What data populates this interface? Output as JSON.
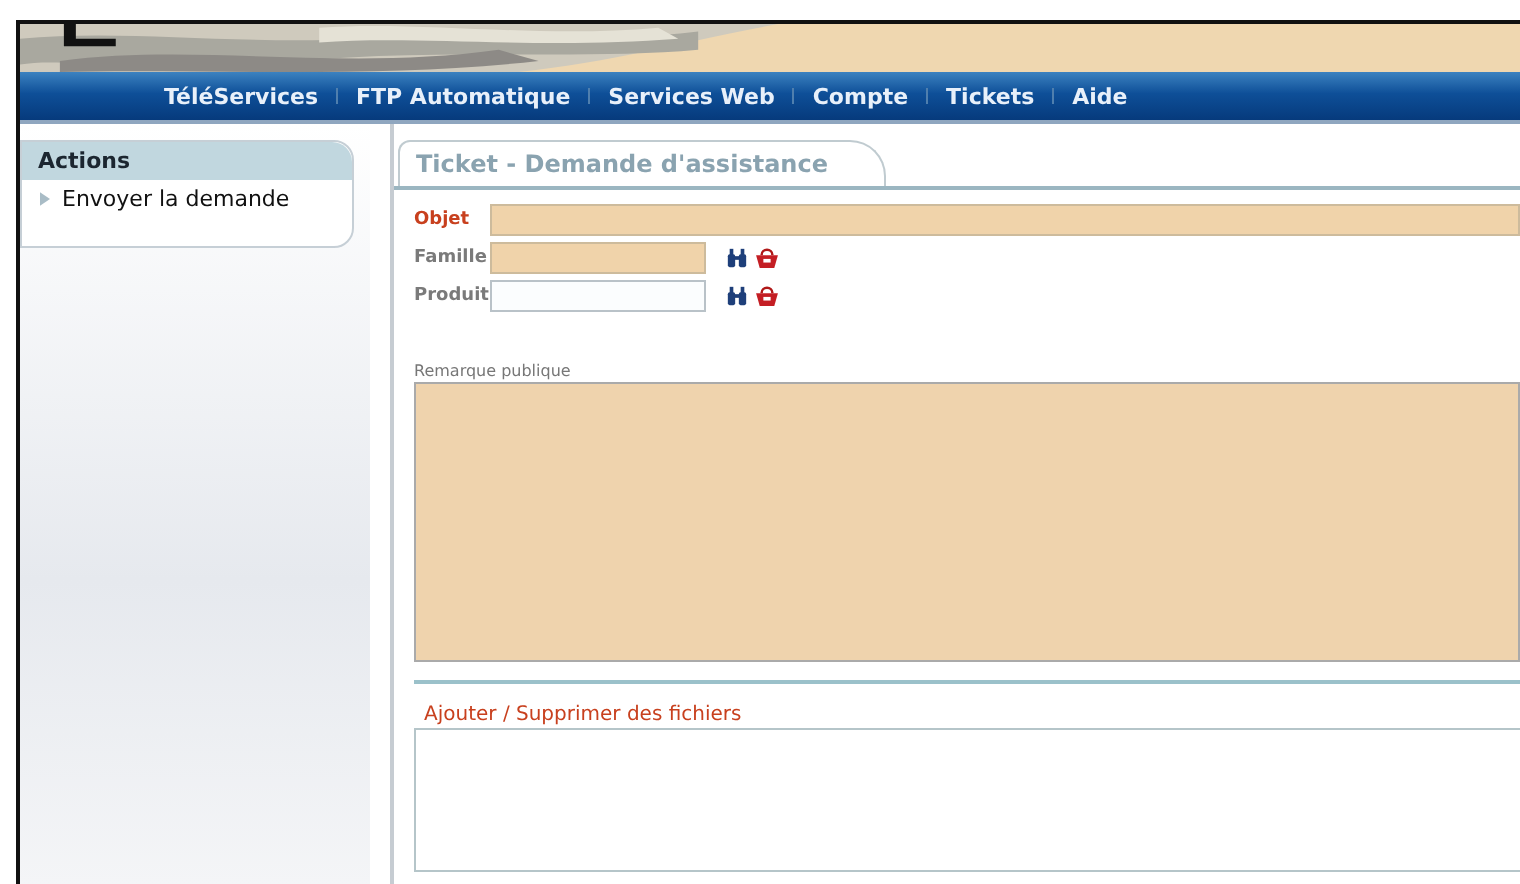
{
  "nav": [
    {
      "label": "TéléServices"
    },
    {
      "label": "FTP Automatique"
    },
    {
      "label": "Services Web"
    },
    {
      "label": "Compte"
    },
    {
      "label": "Tickets"
    },
    {
      "label": "Aide"
    }
  ],
  "sidebar": {
    "title": "Actions",
    "items": [
      {
        "label": "Envoyer la demande"
      }
    ]
  },
  "tab": {
    "title": "Ticket - Demande d'assistance"
  },
  "fields": [
    {
      "label": "Objet",
      "label_highlighted": true,
      "required": true,
      "kind": "wide"
    },
    {
      "label": "Famille",
      "label_highlighted": false,
      "required": true,
      "kind": "lookup"
    },
    {
      "label": "Produit",
      "label_highlighted": false,
      "required": false,
      "kind": "lookup"
    }
  ],
  "remark": {
    "label": "Remarque publique",
    "required": true
  },
  "files": {
    "label": "Ajouter / Supprimer des fichiers"
  }
}
